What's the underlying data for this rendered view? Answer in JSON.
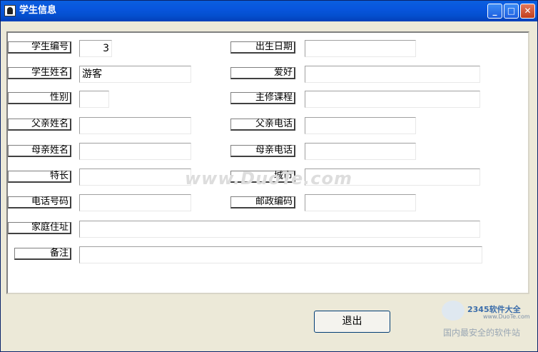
{
  "window": {
    "title": "学生信息"
  },
  "left_fields": [
    {
      "label": "学生编号",
      "value": "3"
    },
    {
      "label": "学生姓名",
      "value": "游客"
    },
    {
      "label": "性别",
      "value": ""
    },
    {
      "label": "父亲姓名",
      "value": ""
    },
    {
      "label": "母亲姓名",
      "value": ""
    },
    {
      "label": "特长",
      "value": ""
    },
    {
      "label": "电话号码",
      "value": ""
    },
    {
      "label": "家庭住址",
      "value": ""
    },
    {
      "label": "备注",
      "value": ""
    }
  ],
  "right_fields": [
    {
      "label": "出生日期",
      "value": ""
    },
    {
      "label": "爱好",
      "value": ""
    },
    {
      "label": "主修课程",
      "value": ""
    },
    {
      "label": "父亲电话",
      "value": ""
    },
    {
      "label": "母亲电话",
      "value": ""
    },
    {
      "label": "城市",
      "value": ""
    },
    {
      "label": "邮政编码",
      "value": ""
    }
  ],
  "watermark": "www.DuoTe.com",
  "buttons": {
    "exit": "退出"
  },
  "corner_logo": {
    "brand": "2345软件大全",
    "url": "www.DuoTe.com",
    "slogan": "国内最安全的软件站"
  }
}
